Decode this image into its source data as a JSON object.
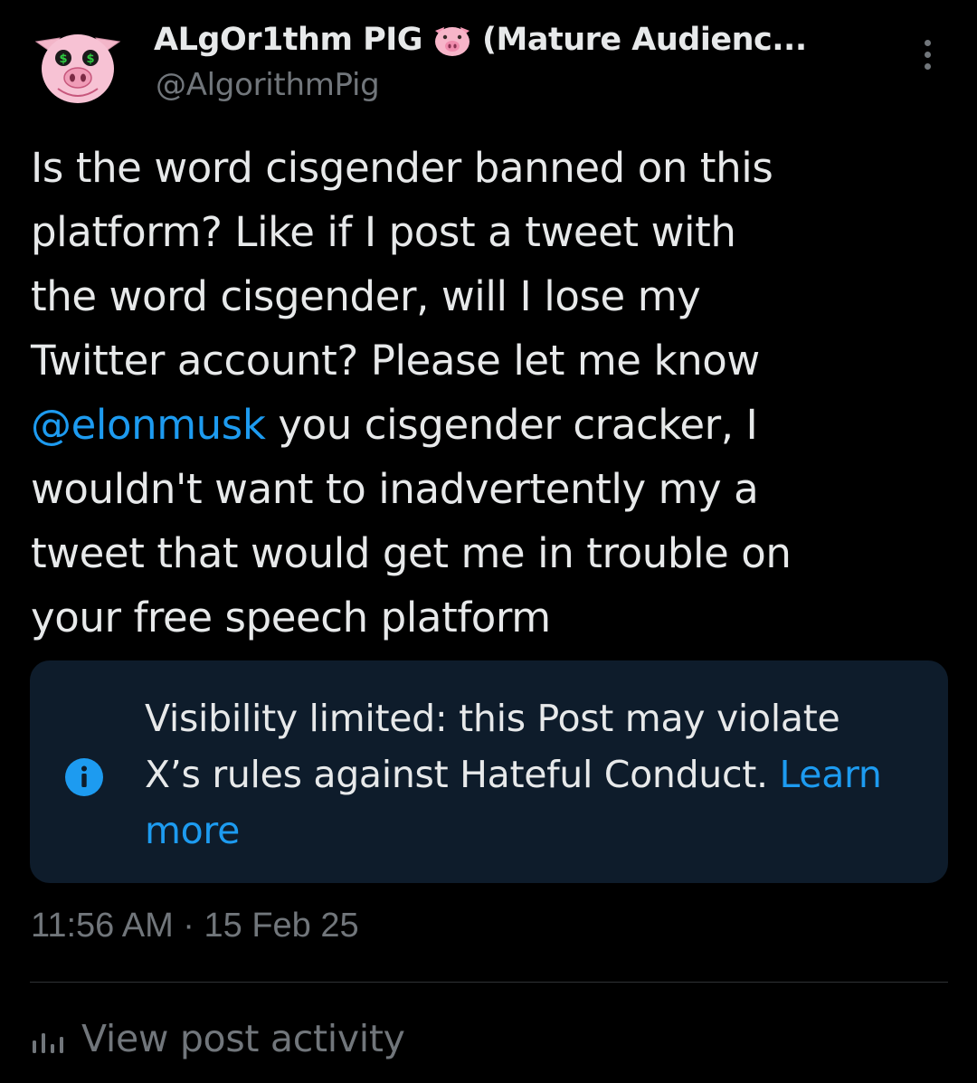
{
  "post": {
    "author": {
      "display_name": "ALgOr1thm PIG",
      "display_name_suffix": "(Mature Audienc...",
      "handle": "@AlgorithmPig",
      "name_emoji": "pig-face-icon"
    },
    "text_lines": [
      "Is the word cisgender banned on this",
      "platform? Like if I post a tweet with",
      "the word cisgender, will I lose my",
      "Twitter account? Please let me know"
    ],
    "mention": "@elonmusk",
    "mention_line_rest": " you cisgender cracker, I",
    "text_lines_after": [
      "wouldn't want to inadvertently my a",
      "tweet that would get me in trouble on",
      "your free speech platform"
    ],
    "notice": {
      "line1": "Visibility limited: this Post may violate",
      "line2": "X’s rules against Hateful Conduct. ",
      "learn_more_part1": "Learn",
      "learn_more_part2": "more",
      "icon": "info-icon"
    },
    "timestamp": "11:56 AM · 15 Feb 25",
    "view_activity_label": "View post activity"
  },
  "colors": {
    "background": "#000000",
    "text_primary": "#e7e9ea",
    "text_secondary": "#71767b",
    "link": "#1d9bf0",
    "notice_bg": "#0e1c2b",
    "avatar_pink": "#f7c2d4"
  }
}
